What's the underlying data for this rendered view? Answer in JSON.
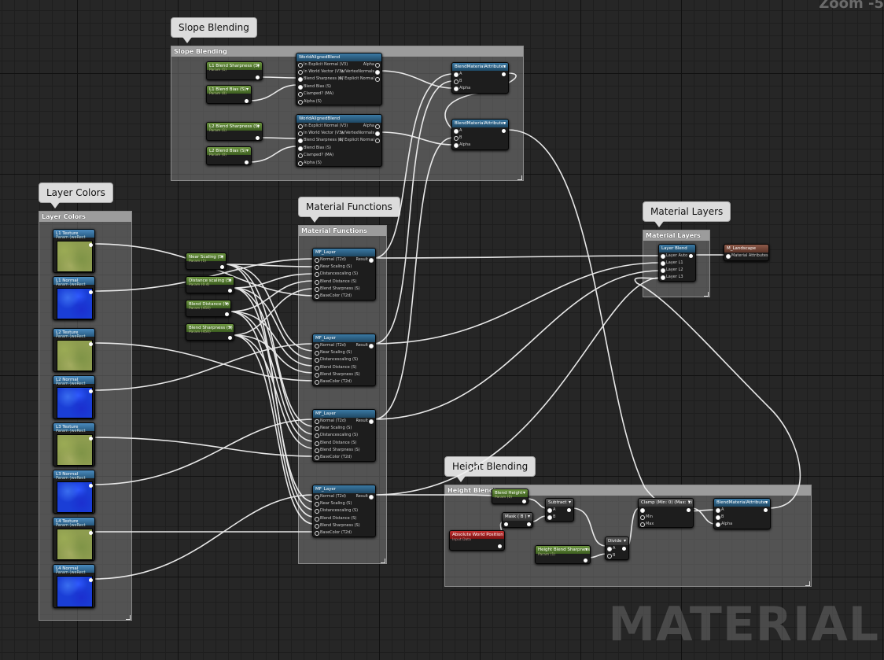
{
  "zoom_label": "Zoom -5",
  "watermark": "MATERIAL",
  "comments": {
    "slope": {
      "bubble": "Slope Blending",
      "header": "Slope Blending"
    },
    "colors": {
      "bubble": "Layer Colors",
      "header": "Layer Colors"
    },
    "functions": {
      "bubble": "Material Functions",
      "header": "Material Functions"
    },
    "layers": {
      "bubble": "Material Layers",
      "header": "Material Layers"
    },
    "height": {
      "bubble": "Height Blending",
      "header": "Height Blending"
    }
  },
  "slope_params": [
    {
      "title": "L1 Blend Sharpness (S)",
      "sub": "Param (1)"
    },
    {
      "title": "L1 Blend Bias (S)",
      "sub": "Param (0)"
    },
    {
      "title": "L2 Blend Sharpness (S)",
      "sub": "Param (1)"
    },
    {
      "title": "L2 Blend Bias (S)",
      "sub": "Param (0)"
    }
  ],
  "world_aligned": {
    "title": "WorldAlignedBlend",
    "inputs": [
      "In Explicit Normal (V3)",
      "In World Vector (V3)",
      "Blend Sharpness (S)",
      "Blend Bias (S)",
      "Clamped? (MA)",
      "Alpha (S)"
    ],
    "outputs": [
      "Alpha",
      "w/VertexNormals",
      "w/ Explicit Normal"
    ]
  },
  "blend_attr": {
    "title": "BlendMaterialAttributes",
    "inputs": [
      "A",
      "B",
      "Alpha"
    ]
  },
  "textures": [
    {
      "title": "L1 Texture",
      "sub": "Param (weRect"
    },
    {
      "title": "L1 Normal",
      "sub": "Param (weRect"
    },
    {
      "title": "L2 Texture",
      "sub": "Param (weRect"
    },
    {
      "title": "L2 Normal",
      "sub": "Param (weRect"
    },
    {
      "title": "L3 Texture",
      "sub": "Param (weRect"
    },
    {
      "title": "L3 Normal",
      "sub": "Param (weRect"
    },
    {
      "title": "L4 Texture",
      "sub": "Param (weRect"
    },
    {
      "title": "L4 Normal",
      "sub": "Param (weRect"
    }
  ],
  "mid_params": [
    {
      "title": "Near Scaling (S)",
      "sub": "Param (1)"
    },
    {
      "title": "Distance scaling (S)",
      "sub": "Param (0.4)"
    },
    {
      "title": "Blend Distance (S)",
      "sub": "Param (450)"
    },
    {
      "title": "Blend Sharpness (S)",
      "sub": "Param (450)"
    }
  ],
  "mf_layer": {
    "title": "MF_Layer",
    "inputs": [
      "Normal (T2d)",
      "Near Scaling (S)",
      "Distancescaling (S)",
      "Blend Distance (S)",
      "Blend Sharpness (S)",
      "BaseColor (T2d)"
    ],
    "output": "Result"
  },
  "layer_blend": {
    "title": "Layer Blend",
    "inputs": [
      "Layer Auto",
      "Layer L1",
      "Layer L2",
      "Layer L3"
    ]
  },
  "landscape": {
    "title": "M_Landscape",
    "input": "Material Attributes"
  },
  "height_nodes": {
    "blend_height": {
      "title": "Blend Height",
      "sub": "Param (0)"
    },
    "mask": {
      "title": "Mask ( B )"
    },
    "abs_pos": {
      "title": "Absolute World Position",
      "sub": "Input Data"
    },
    "subtract": {
      "title": "Subtract",
      "inputs": [
        "A",
        "B"
      ]
    },
    "sharp": {
      "title": "Height Blend Sharpness",
      "sub": "Param (1)"
    },
    "divide": {
      "title": "Divide",
      "inputs": [
        "A",
        "B"
      ]
    },
    "clamp": {
      "title": "Clamp (Min: 0) (Max: 1)",
      "inputs": [
        "",
        "Min",
        "Max"
      ]
    },
    "blend": {
      "title": "BlendMaterialAttributes",
      "inputs": [
        "A",
        "B",
        "Alpha"
      ]
    }
  }
}
